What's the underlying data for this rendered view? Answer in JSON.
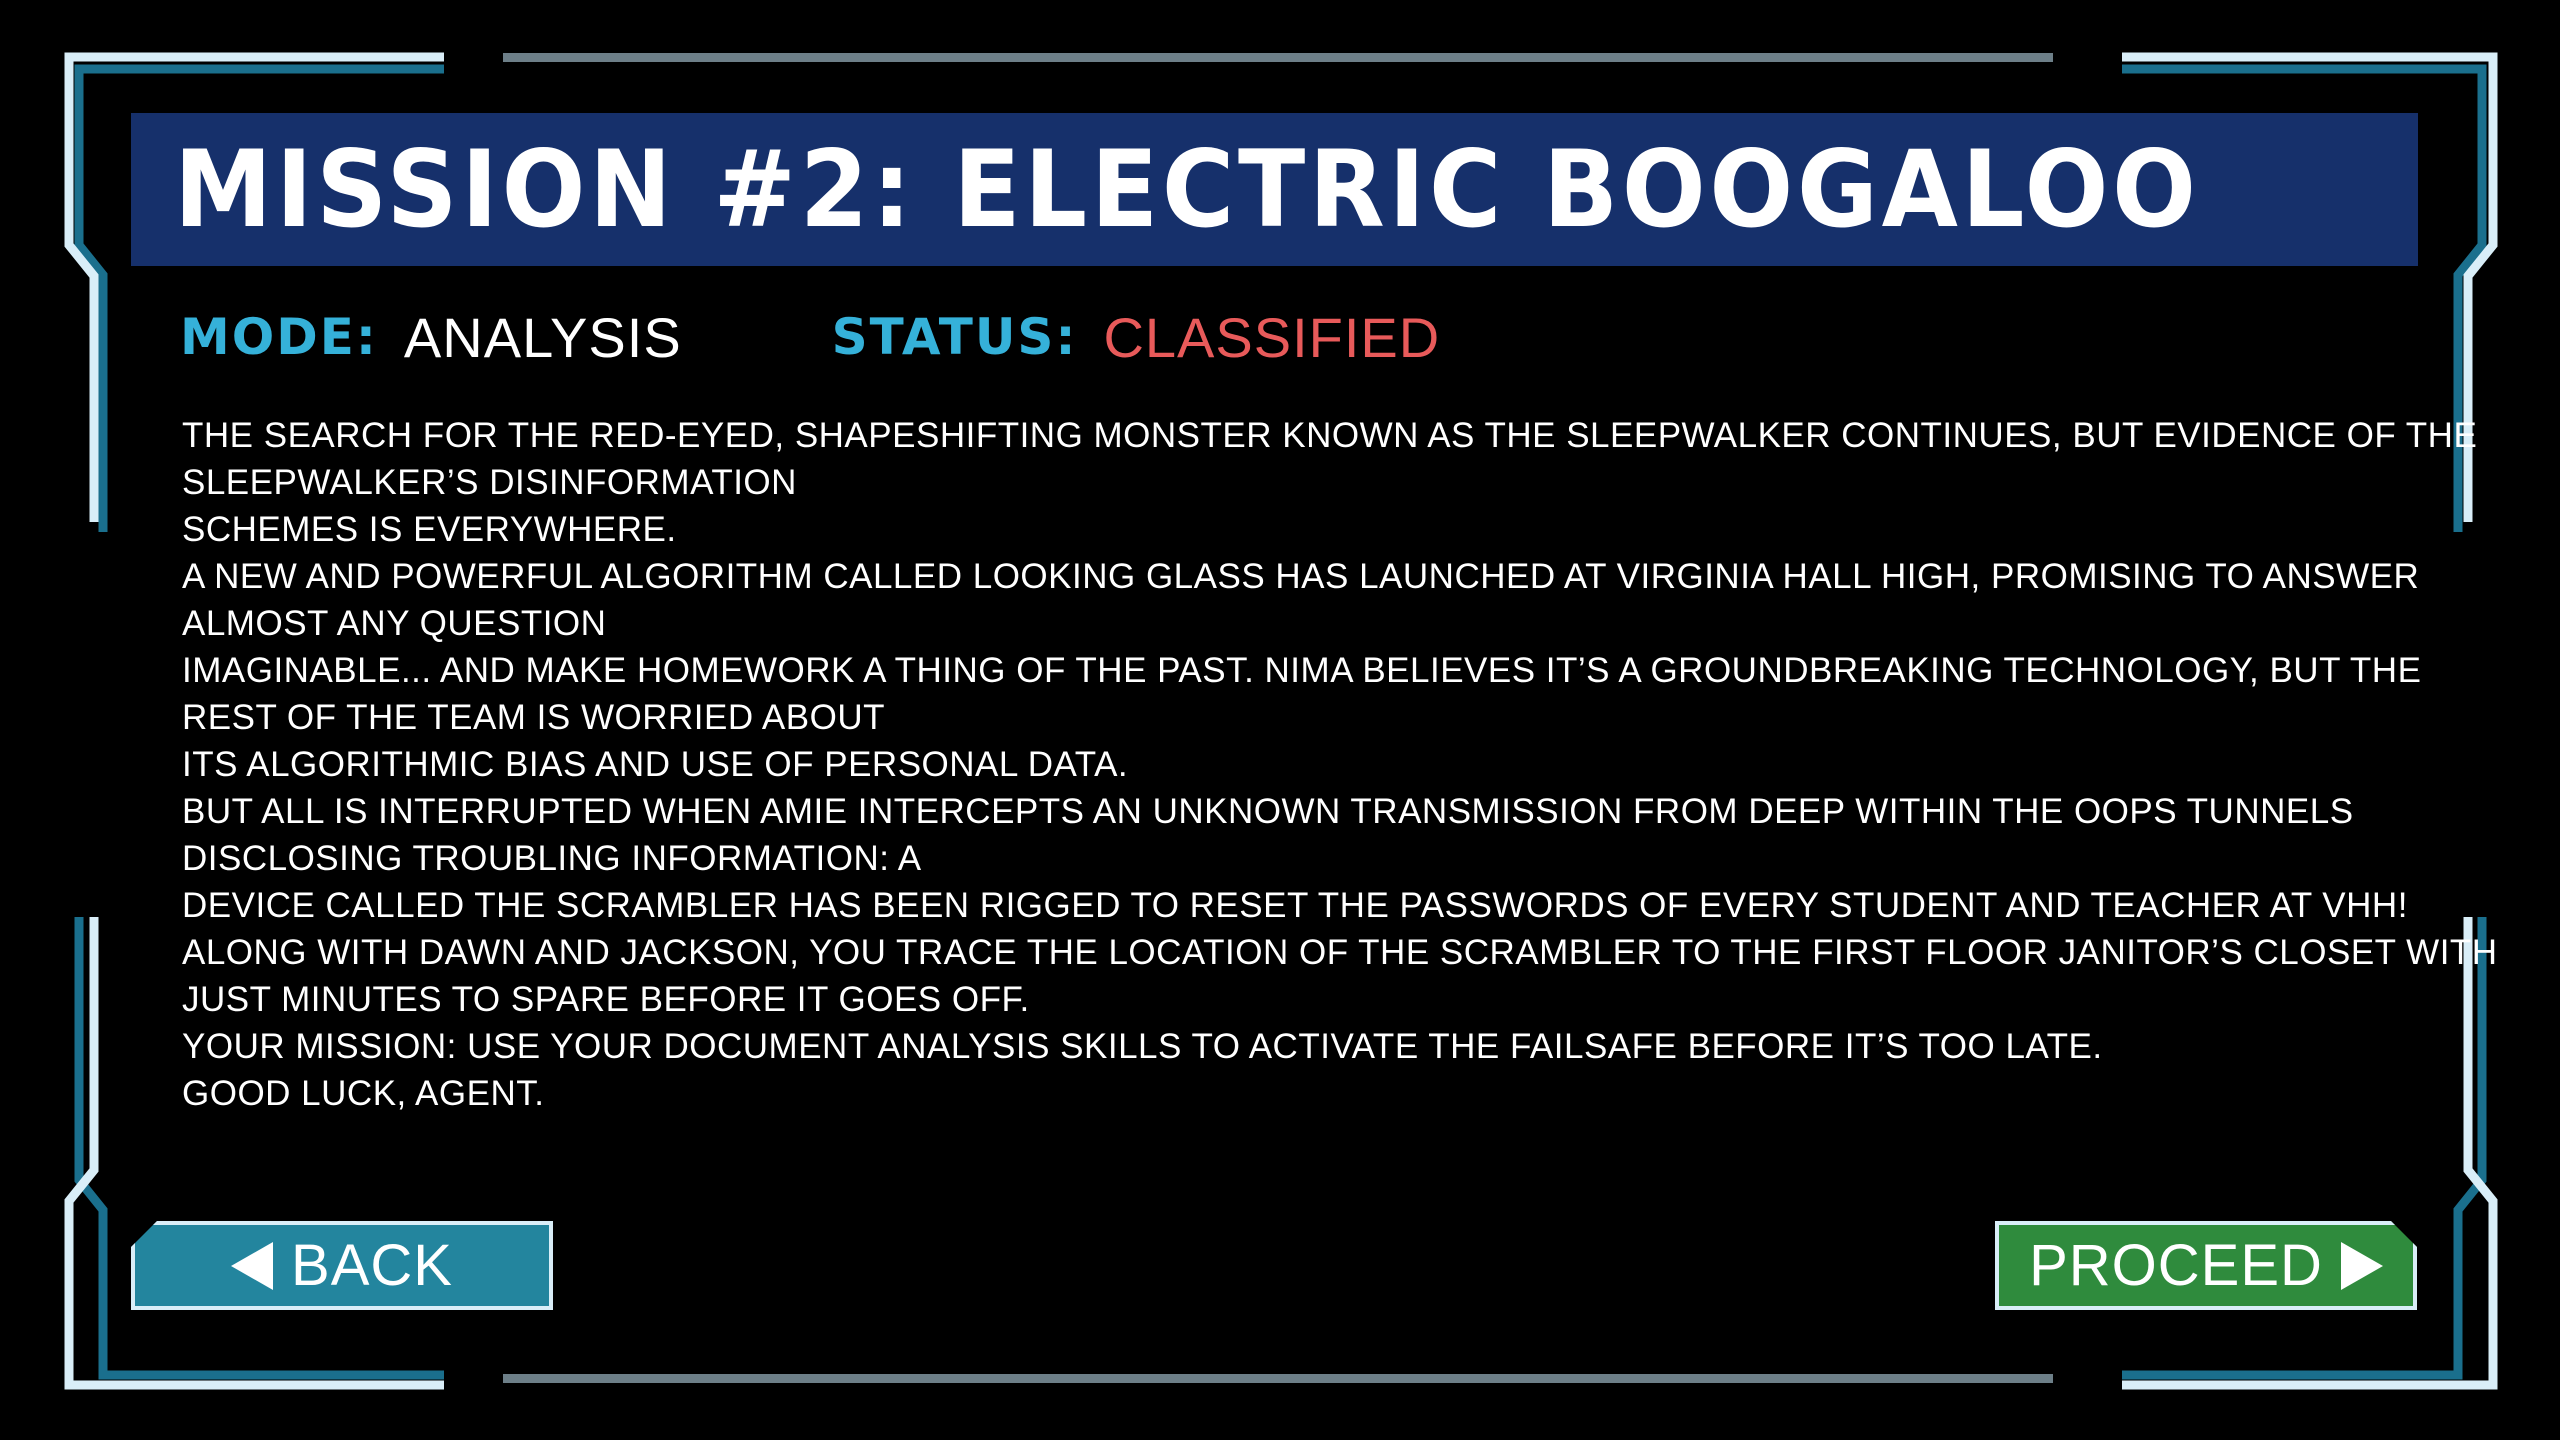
{
  "mission": {
    "title": "MISSION #2: ELECTRIC BOOGALOO",
    "mode_label": "MODE:",
    "mode_value": "ANALYSIS",
    "status_label": "STATUS:",
    "status_value": "CLASSIFIED"
  },
  "briefing_lines": [
    "THE SEARCH FOR THE RED-EYED, SHAPESHIFTING MONSTER KNOWN AS THE SLEEPWALKER CONTINUES, BUT EVIDENCE OF THE",
    "SLEEPWALKER’S DISINFORMATION",
    "SCHEMES IS EVERYWHERE.",
    "A NEW AND POWERFUL ALGORITHM CALLED LOOKING GLASS HAS LAUNCHED AT VIRGINIA HALL HIGH, PROMISING TO ANSWER",
    "ALMOST ANY QUESTION",
    "IMAGINABLE... AND MAKE HOMEWORK A THING OF THE PAST. NIMA BELIEVES IT’S A GROUNDBREAKING TECHNOLOGY, BUT THE",
    "REST OF THE TEAM IS WORRIED ABOUT",
    "ITS ALGORITHMIC BIAS AND USE OF PERSONAL DATA.",
    "BUT ALL IS INTERRUPTED WHEN AMIE INTERCEPTS AN UNKNOWN TRANSMISSION FROM DEEP WITHIN THE OOPS TUNNELS",
    "DISCLOSING TROUBLING INFORMATION: A",
    "DEVICE CALLED THE SCRAMBLER HAS BEEN RIGGED TO RESET THE PASSWORDS OF EVERY STUDENT AND TEACHER AT VHH!",
    "ALONG WITH DAWN AND JACKSON, YOU TRACE THE LOCATION OF THE SCRAMBLER TO THE FIRST FLOOR JANITOR’S CLOSET WITH",
    "JUST MINUTES TO SPARE BEFORE IT GOES OFF.",
    "YOUR MISSION: USE YOUR DOCUMENT ANALYSIS SKILLS TO ACTIVATE THE FAILSAFE BEFORE IT’S TOO LATE.",
    "GOOD LUCK, AGENT."
  ],
  "buttons": {
    "back_label": "BACK",
    "proceed_label": "PROCEED"
  },
  "colors": {
    "background": "#000000",
    "title_bar": "#16306b",
    "label_cyan": "#35b1d9",
    "status_red": "#e85a5a",
    "frame_light": "#d9eef8",
    "frame_shadow": "#1a6f8d",
    "divider_gray": "#6d7f88",
    "back_button": "#23859e",
    "proceed_button": "#2f8b3d"
  }
}
